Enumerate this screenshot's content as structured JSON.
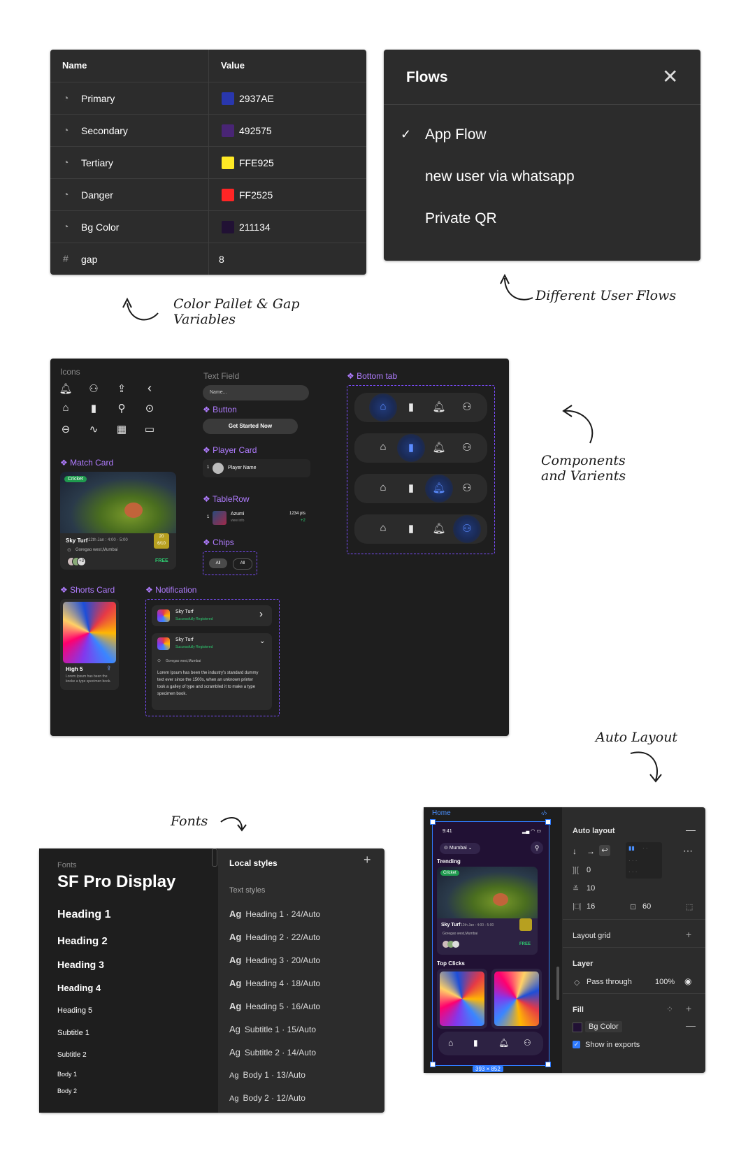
{
  "variables": {
    "headers": {
      "name": "Name",
      "value": "Value"
    },
    "rows": [
      {
        "name": "Primary",
        "value": "2937AE",
        "color": "#2937AE",
        "icon": "palette-icon"
      },
      {
        "name": "Secondary",
        "value": "492575",
        "color": "#492575",
        "icon": "palette-icon"
      },
      {
        "name": "Tertiary",
        "value": "FFE925",
        "color": "#FFE925",
        "icon": "palette-icon"
      },
      {
        "name": "Danger",
        "value": "FF2525",
        "color": "#FF2525",
        "icon": "palette-icon"
      },
      {
        "name": "Bg Color",
        "value": "211134",
        "color": "#211134",
        "icon": "palette-icon"
      },
      {
        "name": "gap",
        "value": "8",
        "icon": "hash-icon"
      }
    ]
  },
  "flows": {
    "title": "Flows",
    "items": [
      "App Flow",
      "new user via whatsapp",
      "Private QR"
    ],
    "checked_item": "App Flow"
  },
  "annotations": {
    "color_pallet": "Color Pallet & Gap",
    "variables": "Variables",
    "user_flows": "Different User Flows",
    "components": "Components",
    "variants": "and Varients",
    "auto_layout": "Auto Layout",
    "fonts": "Fonts"
  },
  "components": {
    "icons_label": "Icons",
    "text_field": {
      "label": "Text Field",
      "placeholder": "Name..."
    },
    "button": {
      "label": "Button",
      "text": "Get Started Now"
    },
    "player_card": {
      "label": "Player Card",
      "index": "1",
      "name": "Player Name"
    },
    "table_row": {
      "label": "TableRow",
      "index": "1",
      "name": "Azumi",
      "sub": "view info",
      "points": "1234 pts",
      "delta": "+2"
    },
    "chips": {
      "label": "Chips",
      "items": [
        "All",
        "All"
      ]
    },
    "match_card": {
      "label": "Match Card",
      "tag": "Cricket",
      "title": "Sky Turf",
      "time": "12th Jan : 4:00 - 5:00",
      "location": "Goregao west,Mumbai",
      "price": "FREE",
      "badge_top": "20",
      "badge_bottom": "6/10",
      "extra": "+3"
    },
    "shorts_card": {
      "label": "Shorts Card",
      "title": "High 5",
      "desc": "Lorem Ipsum has been the kneke a type specimen book."
    },
    "notification": {
      "label": "Notification",
      "title": "Sky Turf",
      "status": "Successfully Registered",
      "location": "Goregao west,Mumbai",
      "body": "Lorem Ipsum has been the industry's standard dummy text ever since the 1500s, when an unknown printer took a galley of type and scrambled it to make a type specimen book."
    },
    "bottom_tab": {
      "label": "Bottom tab",
      "active_index": [
        0,
        1,
        2,
        3
      ]
    }
  },
  "fonts": {
    "section_label": "Fonts",
    "family": "SF Pro Display",
    "samples": [
      "Heading 1",
      "Heading 2",
      "Heading 3",
      "Heading 4",
      "Heading 5",
      "Subtitle 1",
      "Subtitle 2",
      "Body 1",
      "Body 2"
    ],
    "local_styles": "Local styles",
    "text_styles": "Text styles",
    "styles": [
      {
        "name": "Heading 1",
        "spec": "24/Auto"
      },
      {
        "name": "Heading 2",
        "spec": "22/Auto"
      },
      {
        "name": "Heading 3",
        "spec": "20/Auto"
      },
      {
        "name": "Heading 4",
        "spec": "18/Auto"
      },
      {
        "name": "Heading 5",
        "spec": "16/Auto"
      },
      {
        "name": "Subtitle 1",
        "spec": "15/Auto"
      },
      {
        "name": "Subtitle 2",
        "spec": "14/Auto"
      },
      {
        "name": "Body 1",
        "spec": "13/Auto"
      },
      {
        "name": "Body 2",
        "spec": "12/Auto"
      }
    ],
    "ag": "Ag"
  },
  "auto_layout": {
    "frame_name": "Home",
    "time": "9:41",
    "city": "Mumbai",
    "trending": "Trending",
    "top_clicks": "Top Clicks",
    "card_title": "Sky Turf",
    "card_time": "12th Jan : 4:00 - 5:00",
    "card_location": "Goregao west,Mumbai",
    "card_tag": "Cricket",
    "card_price": "FREE",
    "size_label": "393 × 852",
    "panel_title": "Auto layout",
    "spacing_h": "0",
    "spacing_v": "10",
    "padding": "16",
    "padding_v": "60",
    "layout_grid": "Layout grid",
    "layer": "Layer",
    "blend": "Pass through",
    "opacity": "100%",
    "fill": "Fill",
    "fill_name": "Bg Color",
    "show_in_exports": "Show in exports"
  }
}
